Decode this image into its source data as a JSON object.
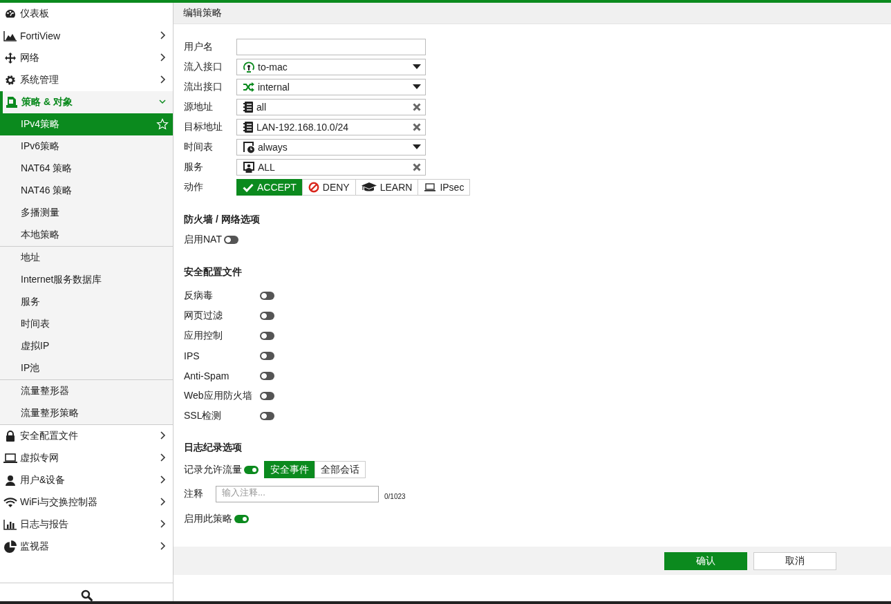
{
  "sidebar": {
    "items": [
      {
        "label": "仪表板",
        "expandable": false,
        "expanded": false
      },
      {
        "label": "FortiView",
        "expandable": true,
        "expanded": false
      },
      {
        "label": "网络",
        "expandable": true,
        "expanded": false
      },
      {
        "label": "系统管理",
        "expandable": true,
        "expanded": false
      },
      {
        "label": "策略 & 对象",
        "expandable": true,
        "expanded": true,
        "child_groups": [
          {
            "children": [
              {
                "label": "IPv4策略",
                "selected": true
              },
              {
                "label": "IPv6策略",
                "selected": false
              },
              {
                "label": "NAT64 策略",
                "selected": false
              },
              {
                "label": "NAT46 策略",
                "selected": false
              },
              {
                "label": "多播测量",
                "selected": false
              },
              {
                "label": "本地策略",
                "selected": false
              }
            ]
          },
          {
            "children": [
              {
                "label": "地址",
                "selected": false
              },
              {
                "label": "Internet服务数据库",
                "selected": false
              },
              {
                "label": "服务",
                "selected": false
              },
              {
                "label": "时间表",
                "selected": false
              },
              {
                "label": "虚拟IP",
                "selected": false
              },
              {
                "label": "IP池",
                "selected": false
              }
            ]
          },
          {
            "children": [
              {
                "label": "流量整形器",
                "selected": false
              },
              {
                "label": "流量整形策略",
                "selected": false
              }
            ]
          }
        ]
      },
      {
        "label": "安全配置文件",
        "expandable": true,
        "expanded": false
      },
      {
        "label": "虚拟专网",
        "expandable": true,
        "expanded": false
      },
      {
        "label": "用户&设备",
        "expandable": true,
        "expanded": false
      },
      {
        "label": "WiFi与交换控制器",
        "expandable": true,
        "expanded": false
      },
      {
        "label": "日志与报告",
        "expandable": true,
        "expanded": false
      },
      {
        "label": "监视器",
        "expandable": true,
        "expanded": false
      }
    ]
  },
  "page": {
    "title": "编辑策略",
    "fields": [
      {
        "label": "用户名",
        "kind": "text"
      },
      {
        "label": "流入接口",
        "kind": "dropdown",
        "value": "to-mac"
      },
      {
        "label": "流出接口",
        "kind": "dropdown",
        "value": "internal"
      },
      {
        "label": "源地址",
        "kind": "removable",
        "value": "all"
      },
      {
        "label": "目标地址",
        "kind": "removable",
        "value": "LAN-192.168.10.0/24"
      },
      {
        "label": "时间表",
        "kind": "dropdown",
        "value": "always"
      },
      {
        "label": "服务",
        "kind": "removable",
        "value": "ALL"
      }
    ],
    "action": {
      "label": "动作",
      "options": [
        {
          "label": "ACCEPT",
          "selected": true
        },
        {
          "label": "DENY",
          "selected": false
        },
        {
          "label": "LEARN",
          "selected": false
        },
        {
          "label": "IPsec",
          "selected": false
        }
      ]
    },
    "firewall": {
      "title": "防火墙 / 网络选项",
      "toggles": [
        {
          "label": "启用NAT",
          "on": false
        }
      ]
    },
    "security_profiles": {
      "title": "安全配置文件",
      "toggles": [
        {
          "label": "反病毒",
          "on": false
        },
        {
          "label": "网页过滤",
          "on": false
        },
        {
          "label": "应用控制",
          "on": false
        },
        {
          "label": "IPS",
          "on": false
        },
        {
          "label": "Anti-Spam",
          "on": false
        },
        {
          "label": "Web应用防火墙",
          "on": false
        },
        {
          "label": "SSL检测",
          "on": false
        }
      ]
    },
    "logging": {
      "title": "日志纪录选项",
      "log_allowed": {
        "label": "记录允许流量",
        "on": true,
        "options": [
          {
            "label": "安全事件",
            "selected": true
          },
          {
            "label": "全部会话",
            "selected": false
          }
        ]
      },
      "comment": {
        "label": "注释",
        "placeholder": "输入注释...",
        "counter": "0/1023"
      },
      "enable": {
        "label": "启用此策略",
        "on": true
      }
    },
    "buttons": {
      "ok": "确认",
      "cancel": "取消"
    }
  }
}
